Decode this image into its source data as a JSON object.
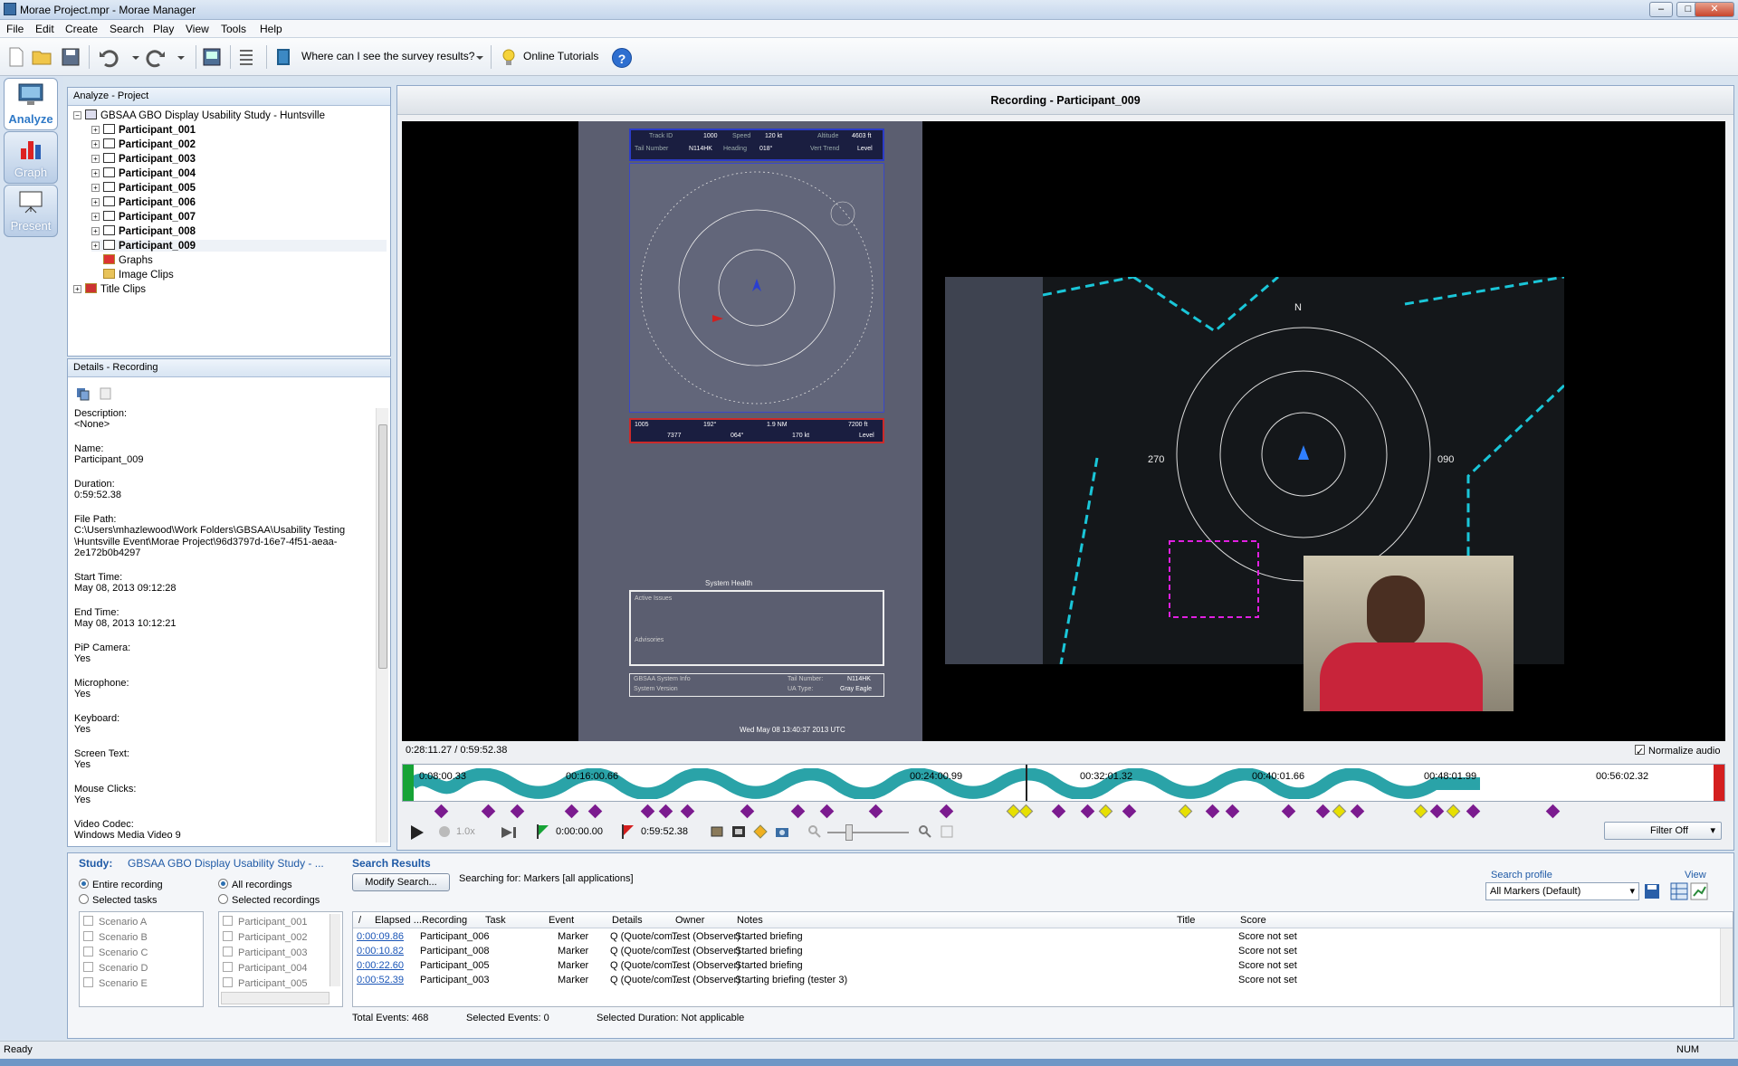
{
  "window": {
    "title": "Morae Project.mpr - Morae Manager",
    "minimize": "–",
    "maximize": "□",
    "close": "✕"
  },
  "menu": [
    "File",
    "Edit",
    "Create",
    "Search",
    "Play",
    "View",
    "Tools",
    "Help"
  ],
  "toolbar": {
    "question": "Where can I see the survey results?",
    "tutorials": "Online Tutorials",
    "help": "?"
  },
  "modes": [
    {
      "label": "Analyze",
      "icon": "monitor-icon"
    },
    {
      "label": "Graph",
      "icon": "bar-chart-icon"
    },
    {
      "label": "Present",
      "icon": "projector-icon"
    }
  ],
  "project_panel": {
    "header": "Analyze - Project",
    "study": "GBSAA GBO Display Usability Study - Huntsville",
    "participants": [
      "Participant_001",
      "Participant_002",
      "Participant_003",
      "Participant_004",
      "Participant_005",
      "Participant_006",
      "Participant_007",
      "Participant_008",
      "Participant_009"
    ],
    "graphs": "Graphs",
    "image_clips": "Image Clips",
    "title_clips": "Title Clips"
  },
  "details_panel": {
    "header": "Details - Recording",
    "fields": [
      {
        "label": "Description:",
        "value": "<None>"
      },
      {
        "label": "Name:",
        "value": "Participant_009"
      },
      {
        "label": "Duration:",
        "value": "0:59:52.38"
      },
      {
        "label": "File Path:",
        "value": "C:\\Users\\mhazlewood\\Work Folders\\GBSAA\\Usability Testing\n\\Huntsville Event\\Morae Project\\96d3797d-16e7-4f51-aeaa-\n2e172b0b4297"
      },
      {
        "label": "Start Time:",
        "value": "May 08, 2013 09:12:28"
      },
      {
        "label": "End Time:",
        "value": "May 08, 2013 10:12:21"
      },
      {
        "label": "PiP Camera:",
        "value": "Yes"
      },
      {
        "label": "Microphone:",
        "value": "Yes"
      },
      {
        "label": "Keyboard:",
        "value": "Yes"
      },
      {
        "label": "Screen Text:",
        "value": "Yes"
      },
      {
        "label": "Mouse Clicks:",
        "value": "Yes"
      },
      {
        "label": "Video Codec:",
        "value": "Windows Media Video 9"
      }
    ]
  },
  "recording": {
    "title": "Recording - Participant_009",
    "time": "0:28:11.27 / 0:59:52.38",
    "normalize_audio": "Normalize audio",
    "timeline_labels": [
      "0:08:00.33",
      "00:16:00.66",
      "00:24:00.99",
      "00:32:01.32",
      "00:40:01.66",
      "00:48:01.99",
      "00:56:02.32"
    ],
    "speed": "1.0x",
    "in_time": "0:00:00.00",
    "out_time": "0:59:52.38",
    "filter": "Filter Off",
    "radar_top": {
      "track_id_label": "Track ID",
      "track_id": "1000",
      "speed_label": "Speed",
      "speed": "120 kt",
      "alt_label": "Altitude",
      "alt": "4603 ft",
      "tail_label": "Tail Number",
      "tail": "N114HK",
      "heading_label": "Heading",
      "heading": "018°",
      "vt_label": "Vert Trend",
      "vt": "Level"
    },
    "radar_bottom": {
      "track_id": "1005",
      "bearing": "192°",
      "range": "1.9 NM",
      "alt": "7200 ft",
      "mode3": "7377",
      "heading": "064°",
      "speed": "170 kt",
      "vt": "Level"
    },
    "system_health": "System Health",
    "active_issues": "Active Issues",
    "advisories": "Advisories",
    "sys_info": "GBSAA System Info",
    "sys_version": "System Version",
    "tail_label": "Tail Number:",
    "tail": "N114HK",
    "ua_label": "UA Type:",
    "ua": "Gray Eagle",
    "clock": "Wed May 08 13:40:37 2013 UTC",
    "compass": {
      "n": "N",
      "e": "090",
      "w": "270"
    }
  },
  "search": {
    "study_label": "Study:",
    "study": "GBSAA GBO Display Usability Study - ...",
    "results_label": "Search Results",
    "entire": "Entire recording",
    "selected_tasks": "Selected tasks",
    "all_recordings": "All recordings",
    "selected_recordings": "Selected recordings",
    "scenarios": [
      "Scenario A",
      "Scenario B",
      "Scenario C",
      "Scenario D",
      "Scenario E"
    ],
    "participants": [
      "Participant_001",
      "Participant_002",
      "Participant_003",
      "Participant_004",
      "Participant_005"
    ],
    "modify": "Modify Search...",
    "searching_for": "Searching for: Markers [all applications]",
    "profile_label": "Search profile",
    "profile": "All Markers (Default)",
    "view_label": "View",
    "columns": [
      "Elapsed ...",
      "Recording",
      "Task",
      "Event",
      "Details",
      "Owner",
      "Notes",
      "Title",
      "Score"
    ],
    "rows": [
      {
        "elapsed": "0:00:09.86",
        "recording": "Participant_006",
        "task": "",
        "event": "Marker",
        "details": "Q (Quote/com...",
        "owner": "Test (Observer)",
        "notes": "Started briefing",
        "title": "",
        "score": "Score not set"
      },
      {
        "elapsed": "0:00:10.82",
        "recording": "Participant_008",
        "task": "",
        "event": "Marker",
        "details": "Q (Quote/com...",
        "owner": "Test (Observer)",
        "notes": "Started briefing",
        "title": "",
        "score": "Score not set"
      },
      {
        "elapsed": "0:00:22.60",
        "recording": "Participant_005",
        "task": "",
        "event": "Marker",
        "details": "Q (Quote/com...",
        "owner": "Test (Observer)",
        "notes": "Started briefing",
        "title": "",
        "score": "Score not set"
      },
      {
        "elapsed": "0:00:52.39",
        "recording": "Participant_003",
        "task": "",
        "event": "Marker",
        "details": "Q (Quote/com...",
        "owner": "Test (Observer)",
        "notes": "Starting briefing (tester 3)",
        "title": "",
        "score": "Score not set"
      }
    ],
    "total_events": "Total Events:  468",
    "selected_events": "Selected Events:  0",
    "selected_duration": "Selected Duration:  Not applicable"
  },
  "status": {
    "left": "Ready",
    "right": "NUM"
  },
  "colors": {
    "accent": "#2f79c7",
    "marker": "#7b1b8f",
    "marker_alt": "#e7e000",
    "waveform": "#2aa3a8",
    "video_bg": "#000000",
    "radar_bg": "#5b5e70"
  }
}
